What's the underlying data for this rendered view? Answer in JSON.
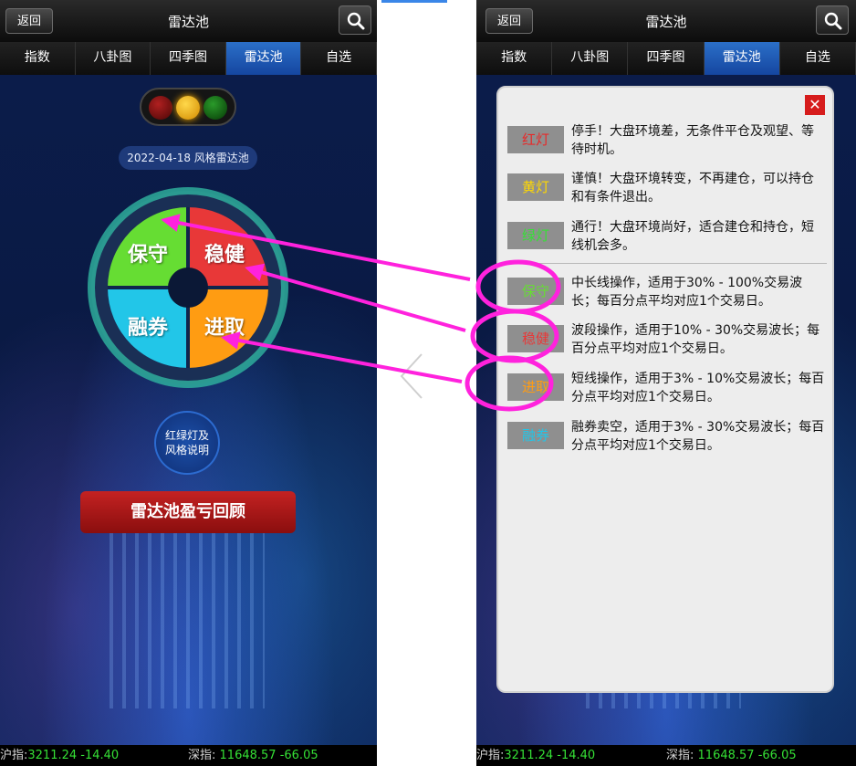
{
  "header": {
    "back_label": "返回",
    "title": "雷达池"
  },
  "tabs": [
    {
      "label": "指数"
    },
    {
      "label": "八卦图"
    },
    {
      "label": "四季图"
    },
    {
      "label": "雷达池"
    },
    {
      "label": "自选"
    }
  ],
  "main": {
    "date_label": "2022-04-18 风格雷达池",
    "quadrants": [
      {
        "label": "保守",
        "color": "#66dd33"
      },
      {
        "label": "稳健",
        "color": "#e83838"
      },
      {
        "label": "融券",
        "color": "#22c6e8"
      },
      {
        "label": "进取",
        "color": "#ff9c12"
      }
    ],
    "info_label_line1": "红绿灯及",
    "info_label_line2": "风格说明",
    "review_label": "雷达池盈亏回顾"
  },
  "footer": {
    "sh_label": "沪指:",
    "sh_value": "3211.24",
    "sh_change": "-14.40",
    "sz_label": "深指:",
    "sz_value": "11648.57",
    "sz_change": "-66.05"
  },
  "modal": {
    "close_label": "✕",
    "items": [
      {
        "chip": "红灯",
        "chip_color": "#e82828",
        "desc": "停手！大盘环境差，无条件平仓及观望、等待时机。"
      },
      {
        "chip": "黄灯",
        "chip_color": "#ffd800",
        "desc": "谨慎！大盘环境转变，不再建仓，可以持仓和有条件退出。"
      },
      {
        "chip": "绿灯",
        "chip_color": "#35e035",
        "desc": "通行！大盘环境尚好，适合建仓和持仓，短线机会多。"
      },
      {
        "chip": "保守",
        "chip_color": "#66dd33",
        "desc": "中长线操作，适用于30% - 100%交易波长；每百分点平均对应1个交易日。"
      },
      {
        "chip": "稳健",
        "chip_color": "#e83838",
        "desc": "波段操作，适用于10% - 30%交易波长；每百分点平均对应1个交易日。"
      },
      {
        "chip": "进取",
        "chip_color": "#ff9c12",
        "desc": "短线操作，适用于3% - 10%交易波长；每百分点平均对应1个交易日。"
      },
      {
        "chip": "融券",
        "chip_color": "#22c6e8",
        "desc": "融券卖空，适用于3% - 30%交易波长；每百分点平均对应1个交易日。"
      }
    ]
  },
  "annotations": {
    "highlight_color": "#ff22dd"
  }
}
